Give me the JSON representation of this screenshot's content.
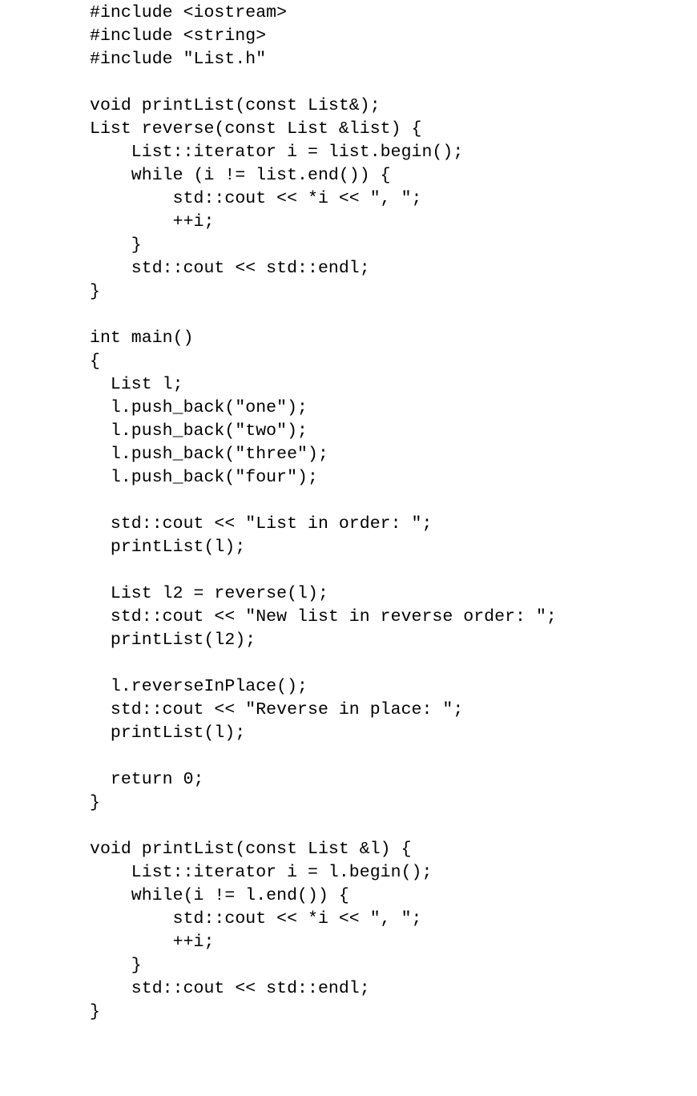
{
  "document": {
    "kind": "source-code-listing",
    "language": "C++",
    "background_color": "#ffffff",
    "text_color": "#000000",
    "font_kind": "monospace"
  },
  "code": {
    "lines": [
      "#include <iostream>",
      "#include <string>",
      "#include \"List.h\"",
      "",
      "void printList(const List&);",
      "List reverse(const List &list) {",
      "    List::iterator i = list.begin();",
      "    while (i != list.end()) {",
      "        std::cout << *i << \", \";",
      "        ++i;",
      "    }",
      "    std::cout << std::endl;",
      "}",
      "",
      "int main()",
      "{",
      "  List l;",
      "  l.push_back(\"one\");",
      "  l.push_back(\"two\");",
      "  l.push_back(\"three\");",
      "  l.push_back(\"four\");",
      "",
      "  std::cout << \"List in order: \";",
      "  printList(l);",
      "",
      "  List l2 = reverse(l);",
      "  std::cout << \"New list in reverse order: \";",
      "  printList(l2);",
      "",
      "  l.reverseInPlace();",
      "  std::cout << \"Reverse in place: \";",
      "  printList(l);",
      "",
      "  return 0;",
      "}",
      "",
      "void printList(const List &l) {",
      "    List::iterator i = l.begin();",
      "    while(i != l.end()) {",
      "        std::cout << *i << \", \";",
      "        ++i;",
      "    }",
      "    std::cout << std::endl;",
      "}"
    ]
  }
}
